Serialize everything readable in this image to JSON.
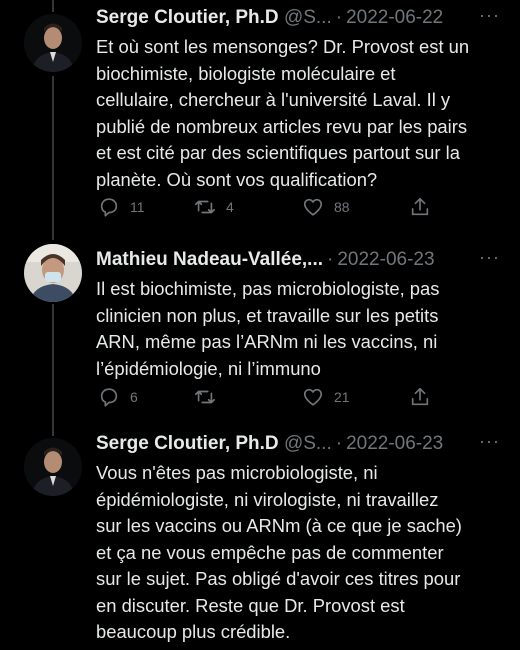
{
  "tweets": [
    {
      "name": "Serge Cloutier, Ph.D",
      "handle": "@S...",
      "date": "2022-06-22",
      "more": "···",
      "text": "Et où sont les mensonges? Dr. Provost est un\nbiochimiste, biologiste moléculaire et\ncellulaire, chercheur à l'université Laval. Il y\npublié de nombreux articles revu par les pairs\net est cité par des scientifiques partout sur la\nplanète. Où sont vos qualification?",
      "replies": "11",
      "retweets": "4",
      "likes": "88",
      "icons": {
        "reply": "reply-icon",
        "retweet": "retweet-icon",
        "like": "heart-icon",
        "share": "share-icon"
      }
    },
    {
      "name": "Mathieu Nadeau-Vallée,...",
      "handle": "",
      "date": "2022-06-23",
      "more": "···",
      "text": "Il est biochimiste, pas microbiologiste, pas\nclinicien non plus, et travaille sur les petits\nARN, même pas l’ARNm ni les vaccins, ni\nl’épidémiologie, ni l’immuno",
      "replies": "6",
      "retweets": "",
      "likes": "21",
      "icons": {
        "reply": "reply-icon",
        "retweet": "retweet-icon",
        "like": "heart-icon",
        "share": "share-icon"
      }
    },
    {
      "name": "Serge Cloutier, Ph.D",
      "handle": "@S...",
      "date": "2022-06-23",
      "more": "···",
      "text": "Vous n'êtes pas microbiologiste, ni\népidémiologiste, ni virologiste, ni travaillez\nsur les vaccins ou ARNm (à ce que je sache)\net ça ne vous empêche pas de commenter\nsur le sujet. Pas obligé d'avoir ces titres pour\nen discuter. Reste que Dr. Provost est\nbeaucoup plus crédible."
    }
  ],
  "colors": {
    "background": "#000000",
    "text": "#e7e9ea",
    "secondary": "#71767b",
    "thread_line": "#333639"
  }
}
